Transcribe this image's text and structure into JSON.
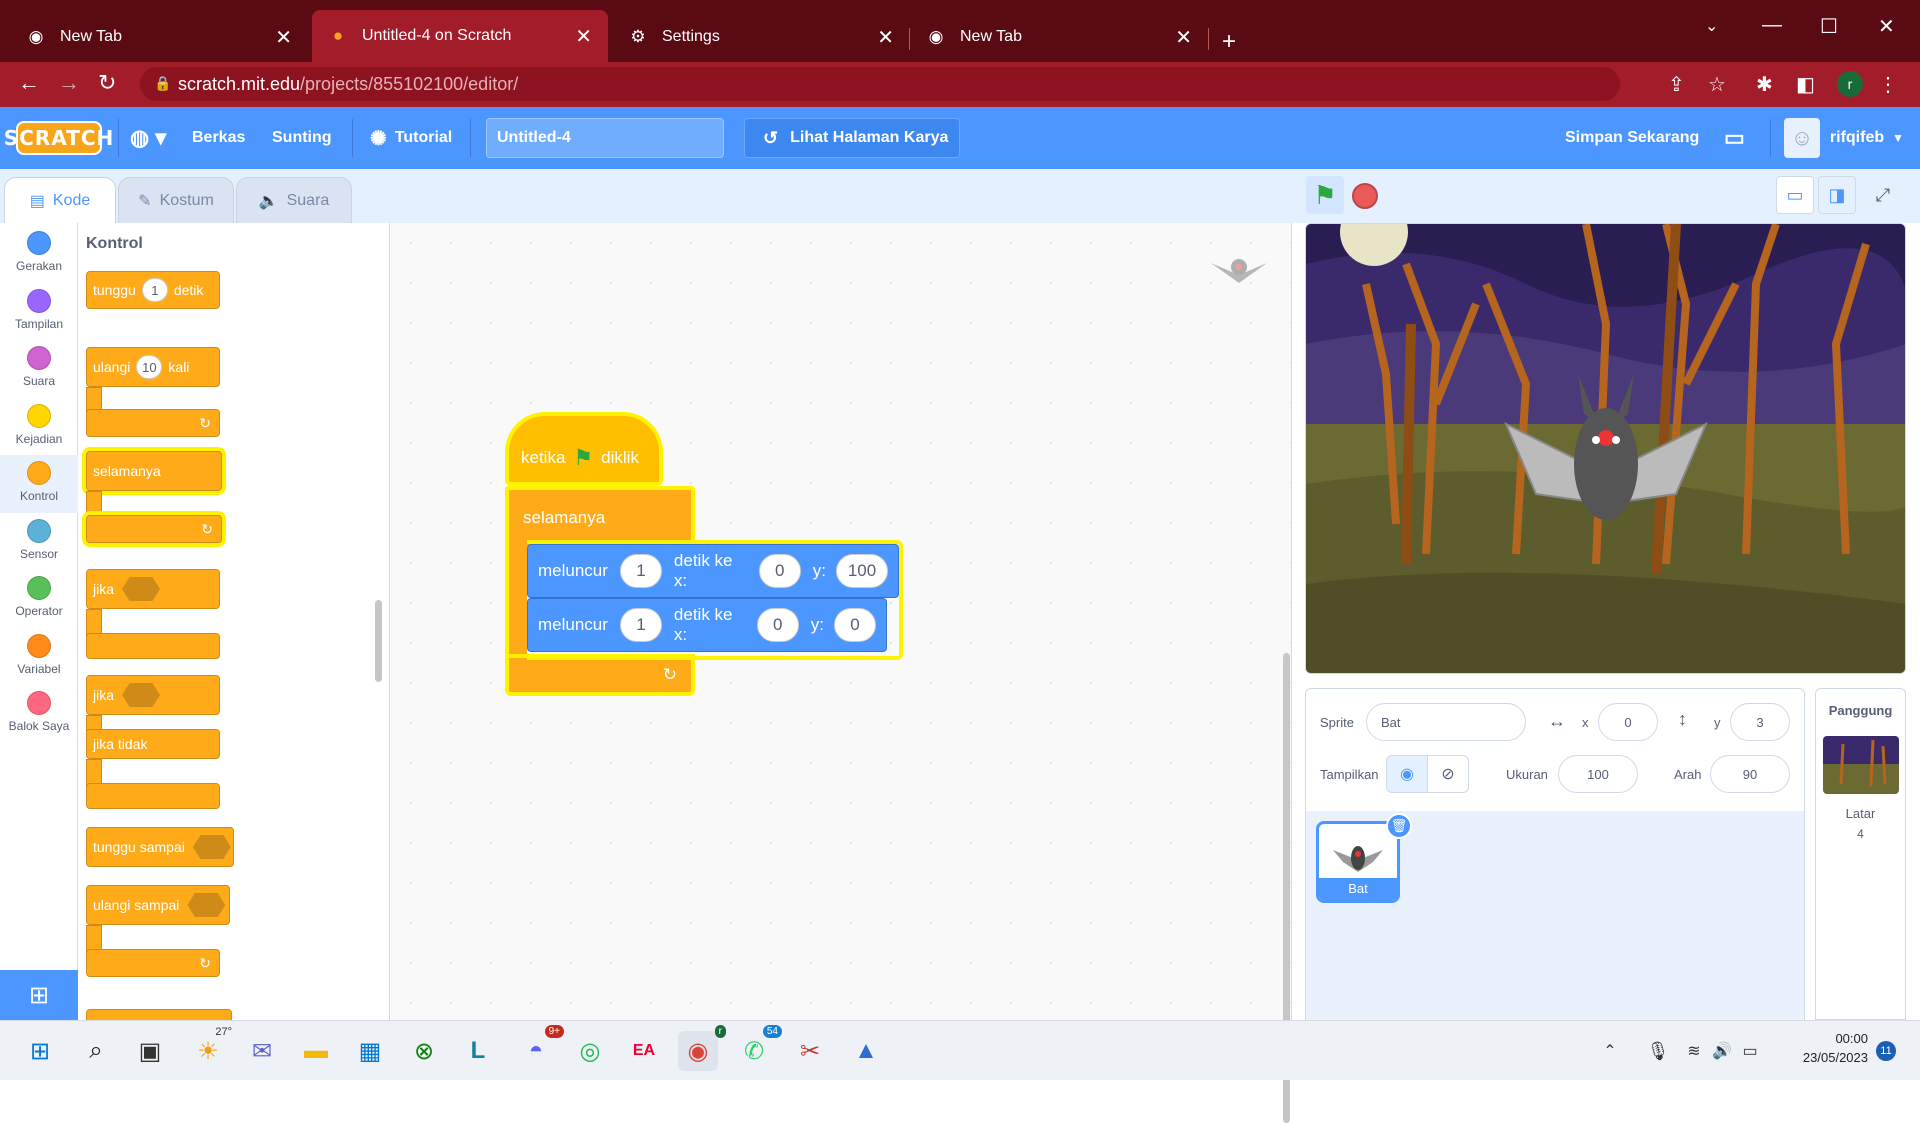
{
  "browser": {
    "tabs": [
      {
        "title": "New Tab",
        "icon": "chrome-icon"
      },
      {
        "title": "Untitled-4 on Scratch",
        "icon": "scratch-icon"
      },
      {
        "title": "Settings",
        "icon": "gear-icon"
      },
      {
        "title": "New Tab",
        "icon": "chrome-icon"
      }
    ],
    "url_host": "scratch.mit.edu",
    "url_path": "/projects/855102100/editor/",
    "profile_initial": "r",
    "accent": "#a21c2a"
  },
  "menu": {
    "logo": "SCRATCH",
    "file": "Berkas",
    "edit": "Sunting",
    "tutorial": "Tutorial",
    "project_title": "Untitled-4",
    "see_project": "Lihat Halaman Karya",
    "save_now": "Simpan Sekarang",
    "username": "rifqifeb"
  },
  "editor_tabs": {
    "code": "Kode",
    "costume": "Kostum",
    "sound": "Suara"
  },
  "categories": [
    {
      "label": "Gerakan",
      "color": "#4c97ff"
    },
    {
      "label": "Tampilan",
      "color": "#9966ff"
    },
    {
      "label": "Suara",
      "color": "#cf63cf"
    },
    {
      "label": "Kejadian",
      "color": "#ffd500"
    },
    {
      "label": "Kontrol",
      "color": "#ffab19"
    },
    {
      "label": "Sensor",
      "color": "#5cb1d6"
    },
    {
      "label": "Operator",
      "color": "#59c059"
    },
    {
      "label": "Variabel",
      "color": "#ff8c1a"
    },
    {
      "label": "Balok Saya",
      "color": "#ff6680"
    }
  ],
  "palette": {
    "title": "Kontrol",
    "wait": "tunggu",
    "wait_value": "1",
    "wait_unit": "detik",
    "repeat": "ulangi",
    "repeat_value": "10",
    "repeat_unit": "kali",
    "forever": "selamanya",
    "if": "jika",
    "if2": "jika",
    "else": "jika tidak",
    "wait_until": "tunggu sampai",
    "repeat_until": "ulangi sampai"
  },
  "script": {
    "hat_when": "ketika",
    "hat_clicked": "diklik",
    "forever": "selamanya",
    "glide1": {
      "label": "meluncur",
      "secs": "1",
      "mid": "detik ke x:",
      "x": "0",
      "ylabel": "y:",
      "y": "100"
    },
    "glide2": {
      "label": "meluncur",
      "secs": "1",
      "mid": "detik ke x:",
      "x": "0",
      "ylabel": "y:",
      "y": "0"
    }
  },
  "sprite_info": {
    "sprite_label": "Sprite",
    "sprite_name": "Bat",
    "x_label": "x",
    "x": "0",
    "y_label": "y",
    "y": "3",
    "show_label": "Tampilkan",
    "size_label": "Ukuran",
    "size": "100",
    "direction_label": "Arah",
    "direction": "90"
  },
  "sprites": [
    {
      "name": "Bat"
    }
  ],
  "stage_panel": {
    "title": "Panggung",
    "backdrops_label": "Latar",
    "backdrops_count": "4"
  },
  "taskbar": {
    "weather_temp": "27°",
    "discord_badge": "9+",
    "whatsapp_badge": "54",
    "chrome_badge": "r",
    "time": "00:00",
    "date": "23/05/2023",
    "notifications": "11"
  }
}
